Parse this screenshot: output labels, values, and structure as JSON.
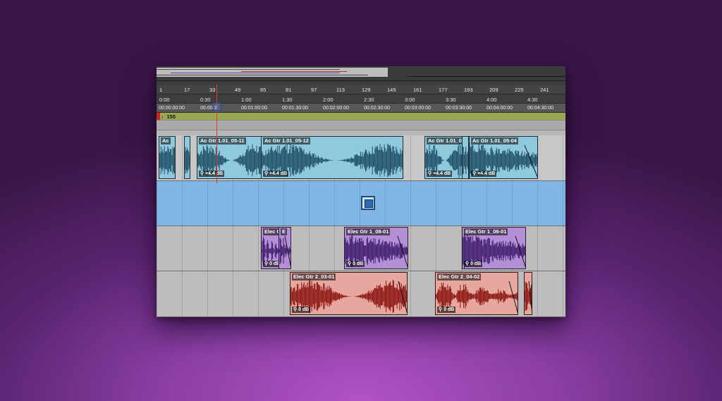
{
  "ruler_bars": [
    "1",
    "17",
    "33",
    "49",
    "65",
    "81",
    "97",
    "113",
    "129",
    "145",
    "161",
    "177",
    "193",
    "209",
    "225",
    "241"
  ],
  "ruler_minsec": [
    "0:00",
    "0:30",
    "1:00",
    "1:30",
    "2:00",
    "2:30",
    "3:00",
    "3:30",
    "4:00",
    "4:30"
  ],
  "ruler_timecode": [
    "00:00:00:00",
    "00:00:3",
    "00:01:00:00",
    "00:01:30:00",
    "00:02:00:00",
    "00:02:30:00",
    "00:03:00:00",
    "00:03:30:00",
    "00:04:00:00",
    "00:04:30:00"
  ],
  "tempo_marker": "♩155",
  "colors": {
    "clip_blue": "#8ec9de",
    "clip_purple": "#b38fd6",
    "clip_red": "#e6a79e",
    "selected_track": "#7fb6e3",
    "playhead": "#e23a2a"
  },
  "tracks": {
    "track1": {
      "clips": [
        {
          "name": "Ac",
          "gain": ""
        },
        {
          "name": "",
          "gain": ""
        },
        {
          "name": "Ac Gtr 1.01_05-11",
          "gain": "+4.4 dB"
        },
        {
          "name": "Ac Gtr 1.01_05-12",
          "gain": "+4.4 dB"
        },
        {
          "name": "Ac Gtr 1.01_05",
          "gain": "+4.4 dB"
        },
        {
          "name": "",
          "gain": ""
        },
        {
          "name": "Ac Gtr 1.01_05-04",
          "gain": "+4.4 dB"
        }
      ]
    },
    "track3": {
      "clips": [
        {
          "name": "Elec G",
          "gain": "0 dB"
        },
        {
          "name": "E",
          "gain": ""
        },
        {
          "name": "Elec Gtr 1_08-01",
          "gain": "0 dB"
        },
        {
          "name": "Elec Gtr 1_08-01",
          "gain": "0 dB"
        }
      ]
    },
    "track4": {
      "clips": [
        {
          "name": "Elec Gtr 2_03-01",
          "gain": "0 dB"
        },
        {
          "name": "Elec Gtr 2_04-02",
          "gain": "0 dB"
        },
        {
          "name": "",
          "gain": ""
        }
      ]
    }
  },
  "group_icon": "clip-group-icon"
}
